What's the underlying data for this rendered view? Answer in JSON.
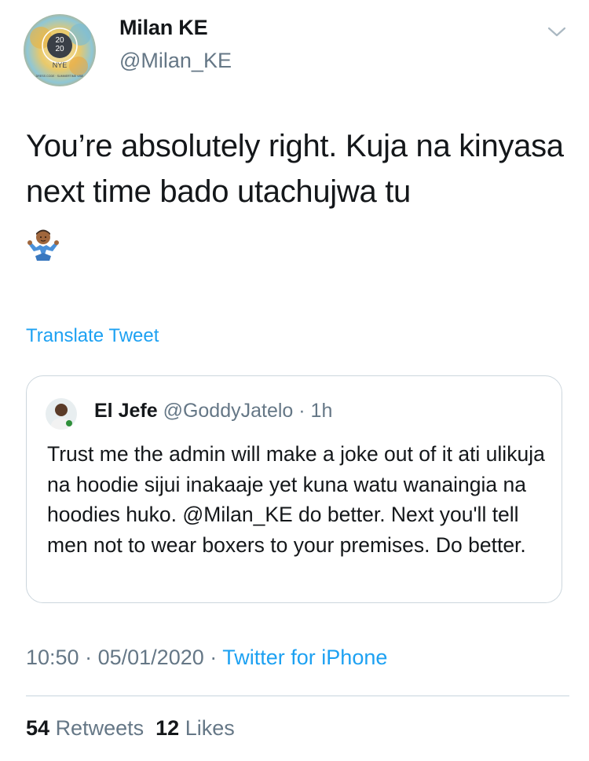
{
  "tweet": {
    "author_name": "Milan KE",
    "author_handle": "@Milan_KE",
    "avatar_text": {
      "year_top": "20",
      "year_bottom": "20",
      "event": "NYE",
      "dress_code": "DRESS CODE · SUMMERTIME VIBE"
    },
    "text": "You’re absolutely right. Kuja na kinyasa next time bado utachujwa tu",
    "emoji": "🤷🏽‍♂️",
    "translate_label": "Translate Tweet",
    "time": "10:50",
    "date": "05/01/2020",
    "separator": "·",
    "source": "Twitter for iPhone",
    "retweets_count": "54",
    "retweets_label": "Retweets",
    "likes_count": "12",
    "likes_label": "Likes"
  },
  "quoted_tweet": {
    "author_name": "El Jefe",
    "author_handle": "@GoddyJatelo",
    "separator": "·",
    "time": "1h",
    "text": "Trust me the admin will make a joke out of it ati ulikuja na hoodie sijui inakaaje yet kuna watu wanaingia na hoodies huko. @Milan_KE do better. Next you'll tell men not to wear boxers to your premises. Do better."
  },
  "icons": {
    "more": "chevron-down-icon"
  },
  "colors": {
    "link": "#1da1f2",
    "secondary_text": "#657786",
    "primary_text": "#14171a",
    "border": "#ccd6dd"
  }
}
